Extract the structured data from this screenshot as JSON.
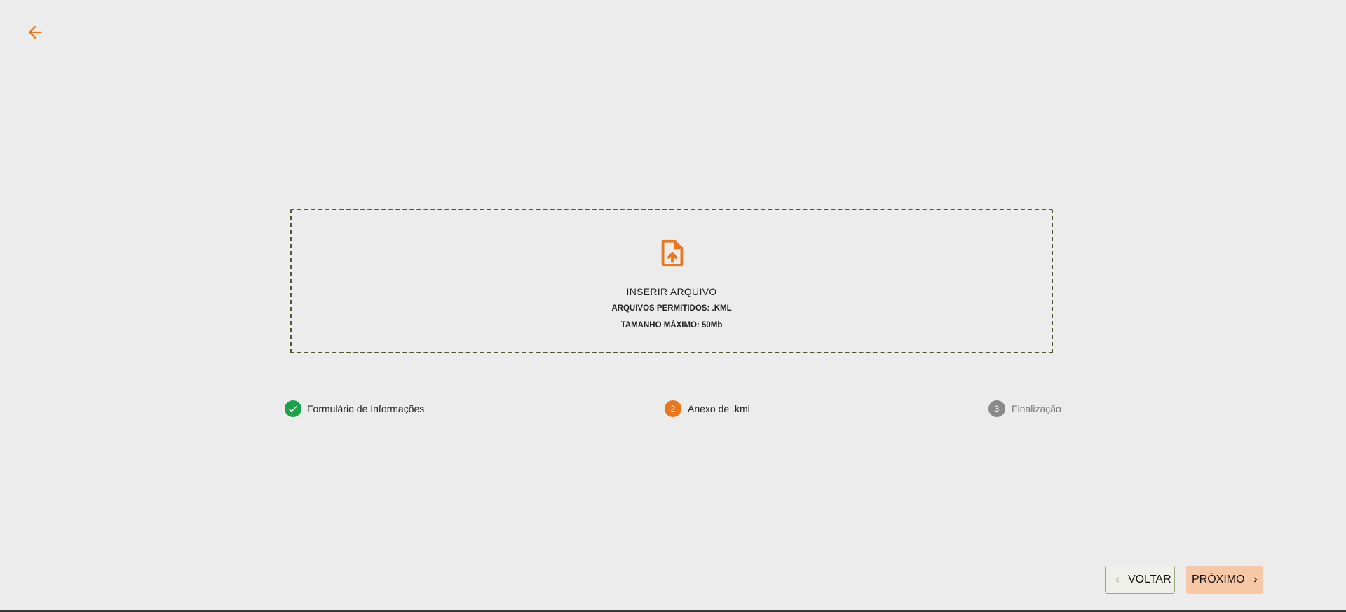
{
  "colors": {
    "accent": "#e87722",
    "success": "#1aa34a",
    "inactive": "#8a8a8a",
    "background": "#ececec",
    "next_button_bg": "#f7c8a5",
    "dropzone_border": "#4a5a2a"
  },
  "header": {
    "back_icon": "arrow-left-icon"
  },
  "dropzone": {
    "icon": "file-upload-icon",
    "title": "INSERIR ARQUIVO",
    "allowed": "ARQUIVOS PERMITIDOS: .KML",
    "max_size": "TAMANHO MÁXIMO: 50Mb"
  },
  "stepper": {
    "steps": [
      {
        "number": "1",
        "label": "Formulário de Informações",
        "status": "completed",
        "icon": "check-icon"
      },
      {
        "number": "2",
        "label": "Anexo de .kml",
        "status": "active"
      },
      {
        "number": "3",
        "label": "Finalização",
        "status": "pending"
      }
    ]
  },
  "footer": {
    "back_label": "VOLTAR",
    "next_label": "PRÓXIMO",
    "back_icon": "chevron-left-icon",
    "next_icon": "chevron-right-icon"
  }
}
